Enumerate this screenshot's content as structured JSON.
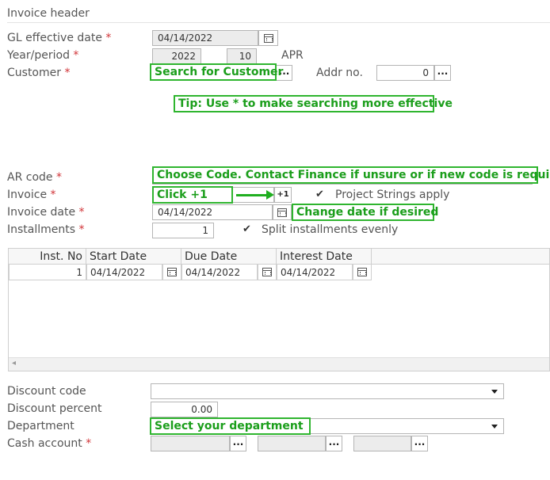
{
  "section": {
    "title": "Invoice header"
  },
  "fields": {
    "gl_effective_date": {
      "label": "GL effective date",
      "value": "04/14/2022"
    },
    "year_period": {
      "label": "Year/period",
      "year": "2022",
      "period": "10",
      "period_name": "APR"
    },
    "customer": {
      "label": "Customer",
      "button": "..."
    },
    "addr_no": {
      "label": "Addr no.",
      "value": "0",
      "button": "..."
    },
    "ar_code": {
      "label": "AR code"
    },
    "invoice": {
      "label": "Invoice",
      "plus_button": "+1"
    },
    "project_strings": {
      "label": "Project Strings apply",
      "checked": true
    },
    "invoice_date": {
      "label": "Invoice date",
      "value": "04/14/2022"
    },
    "installments": {
      "label": "Installments",
      "value": "1"
    },
    "split_evenly": {
      "label": "Split installments evenly",
      "checked": true
    },
    "discount_code": {
      "label": "Discount code",
      "value": ""
    },
    "discount_percent": {
      "label": "Discount percent",
      "value": "0.00"
    },
    "department": {
      "label": "Department",
      "value": ""
    },
    "cash_account": {
      "label": "Cash account",
      "button": "..."
    }
  },
  "required_mark": "*",
  "check_glyph": "✔",
  "grid": {
    "columns": [
      "Inst. No",
      "Start Date",
      "Due Date",
      "Interest Date"
    ],
    "rows": [
      {
        "inst_no": "1",
        "start": "04/14/2022",
        "due": "04/14/2022",
        "interest": "04/14/2022"
      }
    ],
    "scroll_left_glyph": "◂"
  },
  "callouts": {
    "customer": "Search for Customer",
    "tip": "Tip: Use * to make searching more effective",
    "ar_code": "Choose Code. Contact Finance if unsure or if new code is required",
    "invoice": "Click +1",
    "invoice_date": "Change date if desired",
    "department": "Select your department"
  },
  "colors": {
    "callout_green": "#2fb52f",
    "required_red": "#d13438"
  }
}
